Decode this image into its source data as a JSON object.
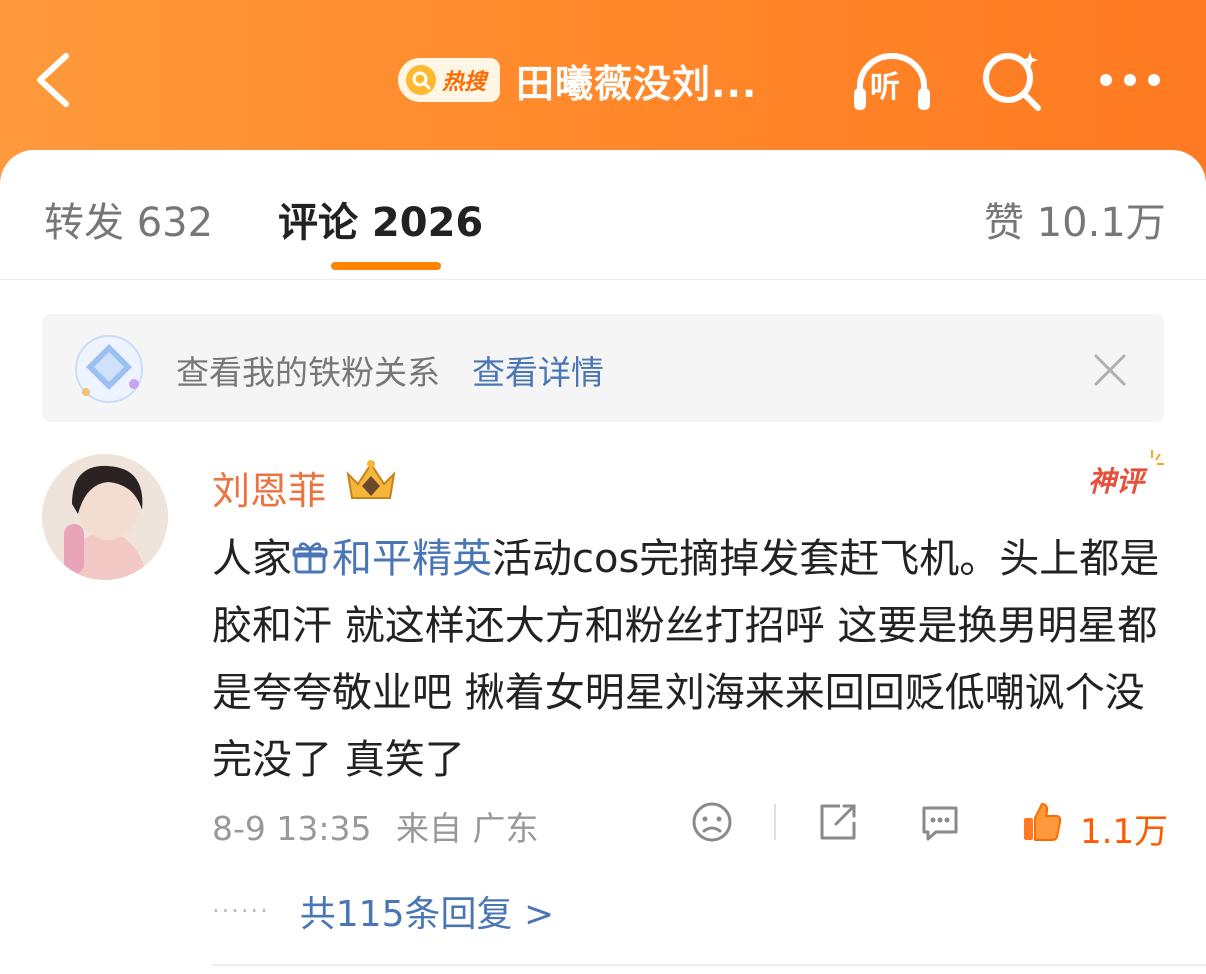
{
  "header": {
    "hot_label": "热搜",
    "title": "田曦薇没刘...",
    "listen_label": "听",
    "background_color": "#ff8a2c"
  },
  "tabs": [
    {
      "label": "转发 632"
    },
    {
      "label": "评论 2026",
      "active": true
    },
    {
      "label": "赞 10.1万"
    }
  ],
  "accent_color": "#ff8200",
  "fan_banner": {
    "text": "查看我的铁粉关系",
    "link": "查看详情"
  },
  "comment": {
    "username": "刘恩菲",
    "badge_icon": "crown-icon",
    "god_comment_label": "神评",
    "text_before": "人家",
    "topic": "和平精英",
    "text_after": "活动cos完摘掉发套赶飞机。头上都是胶和汗 就这样还大方和粉丝打招呼 这要是换男明星都是夸夸敬业吧 揪着女明星刘海来来回回贬低嘲讽个没完没了 真笑了",
    "time": "8-9 13:35",
    "source": "来自 广东",
    "like_count": "1.1万",
    "replies_label": "共115条回复 >",
    "link_color": "#4a76b5",
    "username_color": "#eb7340"
  }
}
